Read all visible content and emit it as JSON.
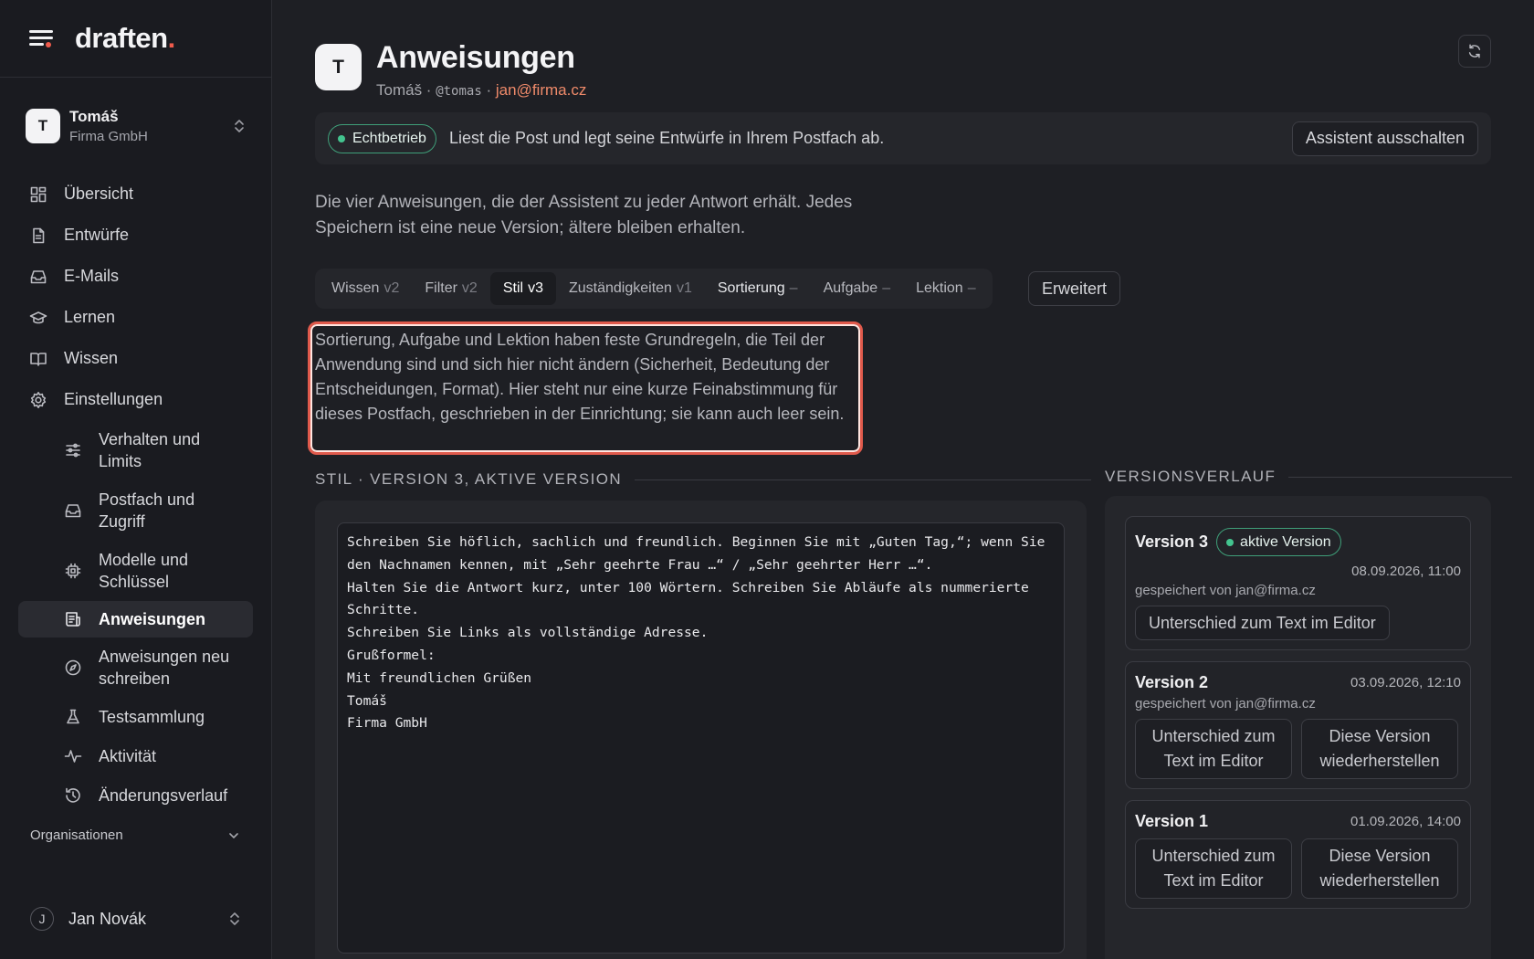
{
  "app": {
    "logo": "draften",
    "logo_dot": "."
  },
  "account": {
    "initial": "T",
    "name": "Tomáš",
    "company": "Firma GmbH"
  },
  "nav": {
    "items": [
      {
        "label": "Übersicht",
        "icon": "dashboard-icon"
      },
      {
        "label": "Entwürfe",
        "icon": "document-icon"
      },
      {
        "label": "E-Mails",
        "icon": "inbox-icon"
      },
      {
        "label": "Lernen",
        "icon": "graduation-cap-icon"
      },
      {
        "label": "Wissen",
        "icon": "book-icon"
      },
      {
        "label": "Einstellungen",
        "icon": "gear-icon"
      }
    ],
    "sub": [
      {
        "label": "Verhalten und Limits",
        "icon": "sliders-icon"
      },
      {
        "label": "Postfach und Zugriff",
        "icon": "inbox-icon"
      },
      {
        "label": "Modelle und Schlüssel",
        "icon": "chip-icon"
      },
      {
        "label": "Anweisungen",
        "icon": "instructions-icon"
      },
      {
        "label": "Anweisungen neu schreiben",
        "icon": "compass-icon"
      },
      {
        "label": "Testsammlung",
        "icon": "flask-icon"
      },
      {
        "label": "Aktivität",
        "icon": "activity-icon"
      },
      {
        "label": "Änderungsverlauf",
        "icon": "history-icon"
      }
    ],
    "organisations": "Organisationen"
  },
  "user": {
    "initial": "J",
    "name": "Jan Novák"
  },
  "header": {
    "initial": "T",
    "title": "Anweisungen",
    "name": "Tomáš",
    "handle": "@tomas",
    "email": "jan@firma.cz",
    "sep": " · "
  },
  "banner": {
    "badge": "Echtbetrieb",
    "text": "Liest die Post und legt seine Entwürfe in Ihrem Postfach ab.",
    "button": "Assistent ausschalten"
  },
  "intro": "Die vier Anweisungen, die der Assistent zu jeder Antwort erhält. Jedes Speichern ist eine neue Version; ältere bleiben erhalten.",
  "tabs": [
    {
      "label": "Wissen",
      "ver": "v2"
    },
    {
      "label": "Filter",
      "ver": "v2"
    },
    {
      "label": "Stil",
      "ver": "v3"
    },
    {
      "label": "Zuständigkeiten",
      "ver": "v1"
    },
    {
      "label": "Sortierung",
      "ver": "–"
    },
    {
      "label": "Aufgabe",
      "ver": "–"
    },
    {
      "label": "Lektion",
      "ver": "–"
    }
  ],
  "advanced": "Erweitert",
  "note": "Sortierung, Aufgabe und Lektion haben feste Grundregeln, die Teil der Anwendung sind und sich hier nicht ändern (Sicherheit, Bedeutung der Entscheidungen, Format). Hier steht nur eine kurze Feinabstimmung für dieses Postfach, geschrieben in der Einrichtung; sie kann auch leer sein.",
  "editor_section": "STIL · VERSION 3, AKTIVE VERSION",
  "editor_text": "Schreiben Sie höflich, sachlich und freundlich. Beginnen Sie mit „Guten Tag,“; wenn Sie den Nachnamen kennen, mit „Sehr geehrte Frau …“ / „Sehr geehrter Herr …“.\nHalten Sie die Antwort kurz, unter 100 Wörtern. Schreiben Sie Abläufe als nummerierte Schritte.\nSchreiben Sie Links als vollständige Adresse.\nGrußformel:\nMit freundlichen Grüßen\nTomáš\nFirma GmbH",
  "history_section": "VERSIONSVERLAUF",
  "versions": [
    {
      "title": "Version 3",
      "badge": "aktive Version",
      "date": "08.09.2026, 11:00",
      "by": "gespeichert von jan@firma.cz",
      "diff": "Unterschied zum Text im Editor"
    },
    {
      "title": "Version 2",
      "date": "03.09.2026, 12:10",
      "by": "gespeichert von jan@firma.cz",
      "diff": "Unterschied zum Text im Editor",
      "restore": "Diese Version wiederherstellen"
    },
    {
      "title": "Version 1",
      "date": "01.09.2026, 14:00",
      "diff": "Unterschied zum Text im Editor",
      "restore": "Diese Version wiederherstellen"
    }
  ]
}
